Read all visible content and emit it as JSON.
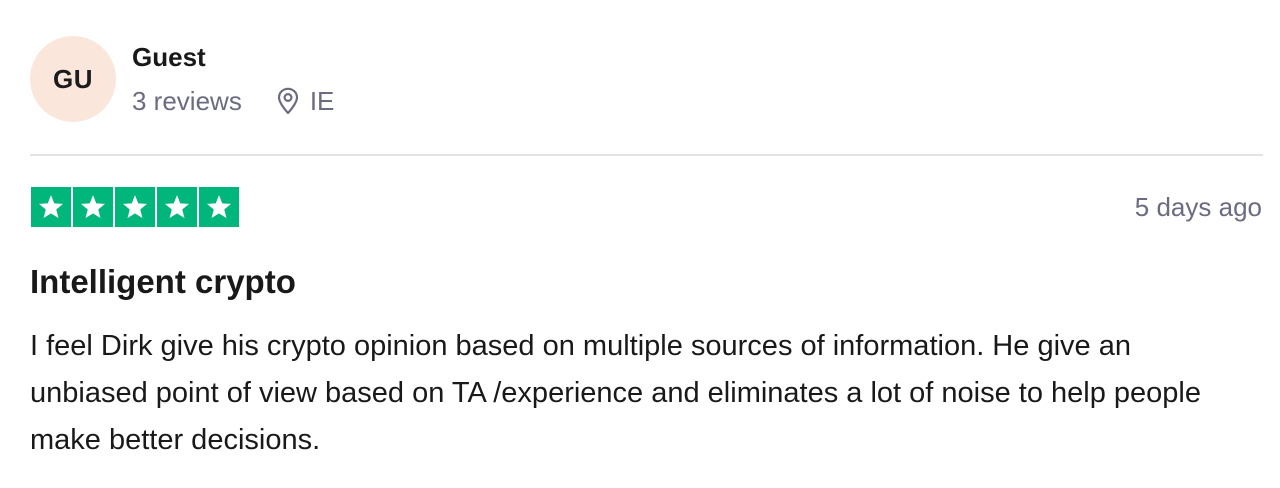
{
  "reviewer": {
    "initials": "GU",
    "name": "Guest",
    "reviews_count": "3 reviews",
    "location": "IE",
    "avatar_color": "#fbe6dc"
  },
  "review": {
    "rating": 5,
    "rating_max": 5,
    "star_color": "#00b67a",
    "date": "5 days ago",
    "title": "Intelligent crypto",
    "body": "I feel Dirk give his crypto opinion based on multiple sources of information. He give an unbiased point of view based on TA /experience and eliminates a lot of noise to help people make better decisions."
  },
  "icons": {
    "location": "location-pin-icon",
    "star": "star-icon"
  }
}
